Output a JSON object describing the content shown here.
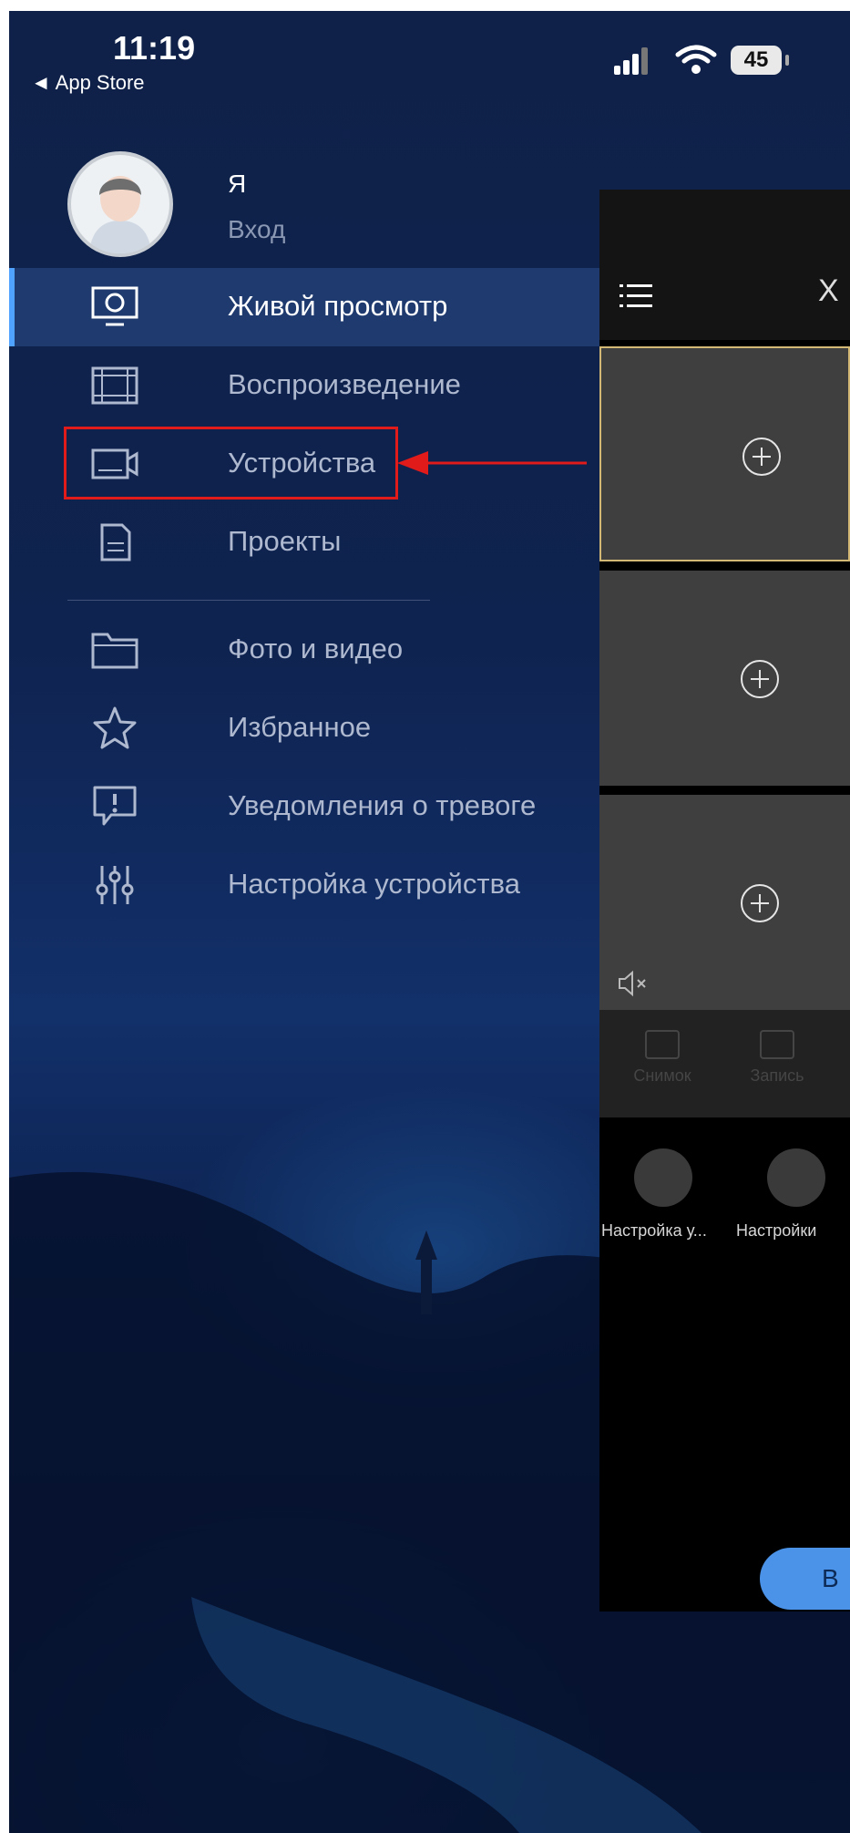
{
  "status_bar": {
    "time": "11:19",
    "back": "◄ App Store",
    "battery": "45"
  },
  "profile": {
    "name": "Я",
    "login": "Вход"
  },
  "menu": {
    "items": [
      {
        "label": "Живой просмотр",
        "icon": "monitor-icon",
        "active": true
      },
      {
        "label": "Воспроизведение",
        "icon": "film-icon"
      },
      {
        "label": "Устройства",
        "icon": "camera-icon",
        "highlighted": true
      },
      {
        "label": "Проекты",
        "icon": "document-icon"
      },
      {
        "label": "Фото и видео",
        "icon": "folder-icon"
      },
      {
        "label": "Избранное",
        "icon": "star-icon"
      },
      {
        "label": "Уведомления о тревоге",
        "icon": "alarm-message-icon"
      },
      {
        "label": "Настройка устройства",
        "icon": "sliders-icon"
      }
    ]
  },
  "panel": {
    "close": "X",
    "toolbar": {
      "snapshot": "Снимок",
      "record": "Запись"
    },
    "shortcuts": [
      {
        "label": "Настройка у..."
      },
      {
        "label": "Настройки"
      }
    ],
    "button": "В"
  },
  "colors": {
    "accent": "#4fa2ff",
    "highlight": "#e11a1a",
    "active_row": "#1e3a6e",
    "selected_cell": "#d3b775"
  }
}
